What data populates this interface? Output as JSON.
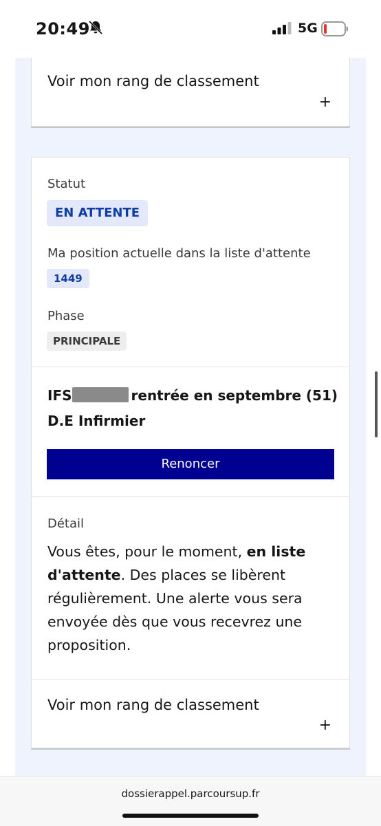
{
  "status_bar": {
    "time": "20:49",
    "network": "5G"
  },
  "top_card": {
    "rang_label": "Voir mon rang de classement",
    "plus": "+"
  },
  "status": {
    "label": "Statut",
    "value": "EN ATTENTE"
  },
  "position": {
    "label": "Ma position actuelle dans la liste d'attente",
    "value": "1449"
  },
  "phase": {
    "label": "Phase",
    "value": "PRINCIPALE"
  },
  "formation": {
    "prefix": "IFS",
    "suffix": "rentrée en septembre (51)",
    "line2": "D.E Infirmier"
  },
  "action": {
    "renoncer_label": "Renoncer"
  },
  "detail": {
    "label": "Détail",
    "text_before": "Vous êtes, pour le moment, ",
    "text_bold": "en liste d'attente",
    "text_after": ". Des places se libèrent régulièrement. Une alerte vous sera envoyée dès que vous recevrez une proposition."
  },
  "bottom_card": {
    "rang_label": "Voir mon rang de classement",
    "plus": "+"
  },
  "browser": {
    "url": "dossierappel.parcoursup.fr"
  }
}
